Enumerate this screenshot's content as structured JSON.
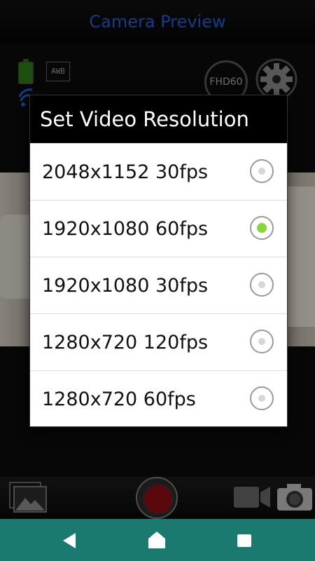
{
  "app": {
    "title": "Camera Preview",
    "status": {
      "battery_icon": "battery-full-icon",
      "awb_label": "AWB",
      "wifi_icon": "wifi-icon"
    },
    "resolution_badge": "FHD60",
    "settings_icon": "gear-icon"
  },
  "dialog": {
    "title": "Set Video Resolution",
    "options": [
      {
        "label": "2048x1152 30fps",
        "selected": false
      },
      {
        "label": "1920x1080 60fps",
        "selected": true
      },
      {
        "label": "1920x1080 30fps",
        "selected": false
      },
      {
        "label": "1280x720 120fps",
        "selected": false
      },
      {
        "label": "1280x720 60fps",
        "selected": false
      }
    ],
    "selected_color": "#8bd33b"
  },
  "toolbar": {
    "gallery_icon": "gallery-icon",
    "record_icon": "record-button-icon",
    "video_mode_icon": "video-camera-icon",
    "photo_mode_icon": "photo-camera-icon"
  },
  "navbar": {
    "back_icon": "back-triangle-icon",
    "home_icon": "home-icon",
    "recent_icon": "recent-apps-icon",
    "color": "#1a7a70"
  }
}
